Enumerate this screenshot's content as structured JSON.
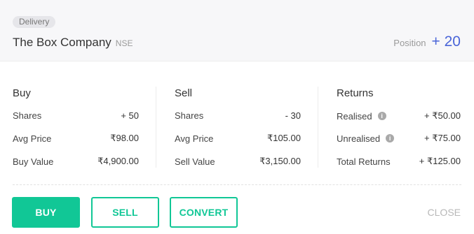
{
  "header": {
    "badge": "Delivery",
    "company_name": "The Box Company",
    "exchange": "NSE",
    "position_label": "Position",
    "position_value": "+ 20"
  },
  "buy": {
    "title": "Buy",
    "rows": [
      {
        "label": "Shares",
        "value": "+ 50"
      },
      {
        "label": "Avg Price",
        "value": "₹98.00"
      },
      {
        "label": "Buy Value",
        "value": "₹4,900.00"
      }
    ]
  },
  "sell": {
    "title": "Sell",
    "rows": [
      {
        "label": "Shares",
        "value": "- 30"
      },
      {
        "label": "Avg Price",
        "value": "₹105.00"
      },
      {
        "label": "Sell Value",
        "value": "₹3,150.00"
      }
    ]
  },
  "returns": {
    "title": "Returns",
    "rows": [
      {
        "label": "Realised",
        "value": "+ ₹50.00",
        "icon": "info-icon"
      },
      {
        "label": "Unrealised",
        "value": "+ ₹75.00",
        "icon": "info-icon"
      },
      {
        "label": "Total Returns",
        "value": "+ ₹125.00"
      }
    ]
  },
  "actions": {
    "buy_label": "BUY",
    "sell_label": "SELL",
    "convert_label": "CONVERT",
    "close_label": "CLOSE"
  },
  "colors": {
    "accent_green": "#11c796",
    "position_blue": "#4a65d8",
    "negative_red": "#e0533a"
  }
}
